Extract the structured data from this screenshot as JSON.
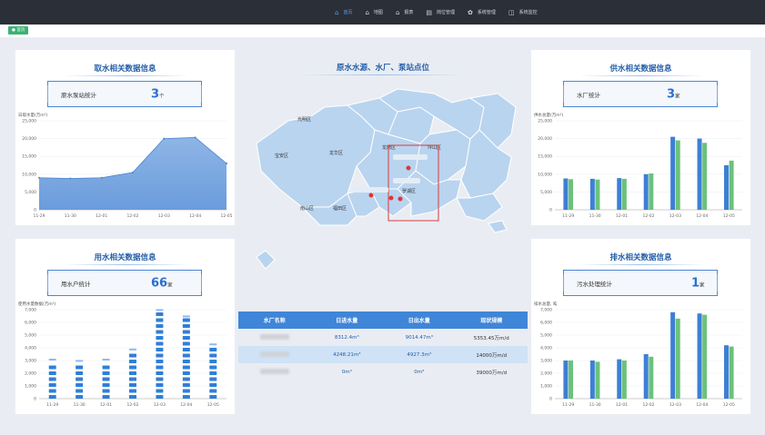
{
  "nav": {
    "items": [
      {
        "label": "首页",
        "icon": "home-icon",
        "active": true
      },
      {
        "label": "地图",
        "icon": "map-icon",
        "active": false
      },
      {
        "label": "报表",
        "icon": "report-icon",
        "active": false
      },
      {
        "label": "岗位管理",
        "icon": "user-icon",
        "active": false
      },
      {
        "label": "系统管理",
        "icon": "gear-icon",
        "active": false
      },
      {
        "label": "系统监控",
        "icon": "shield-icon",
        "active": false
      }
    ]
  },
  "tab": {
    "home_label": "首页"
  },
  "intake": {
    "title": "取水相关数据信息",
    "stat_label": "原水泵站统计",
    "stat_value": "3",
    "stat_unit": "个",
    "axis_unit": "日取水量(万m³)"
  },
  "usage": {
    "title": "用水相关数据信息",
    "stat_label": "用水户统计",
    "stat_value": "66",
    "stat_unit": "家",
    "axis_unit": "使用水量数据(万m³)"
  },
  "supply": {
    "title": "供水相关数据信息",
    "stat_label": "水厂统计",
    "stat_value": "3",
    "stat_unit": "家",
    "axis_unit": "供水总量(万m³)"
  },
  "drain": {
    "title": "排水相关数据信息",
    "stat_label": "污水处理统计",
    "stat_value": "1",
    "stat_unit": "家",
    "axis_unit": "排水总量, 吨"
  },
  "map": {
    "title": "原水水源、水厂、泵站点位",
    "districts": [
      "光明区",
      "宝安区",
      "龙华区",
      "龙岗区",
      "坪山区",
      "南山区",
      "福田区",
      "罗湖区"
    ]
  },
  "table": {
    "headers": [
      "水厂名称",
      "日进水量",
      "日出水量",
      "现状规模"
    ],
    "rows": [
      {
        "inflow": "8312.4m³",
        "outflow": "9014.47m³",
        "scale": "5353.45万m/d"
      },
      {
        "inflow": "4248.21m³",
        "outflow": "4927.3m³",
        "scale": "14000万m/d"
      },
      {
        "inflow": "0m³",
        "outflow": "0m³",
        "scale": "39000万m/d"
      }
    ]
  },
  "chart_data": [
    {
      "type": "area",
      "title": "",
      "ylabel": "日取水量(万m³)",
      "categories": [
        "11-29",
        "11-30",
        "12-01",
        "12-02",
        "12-03",
        "12-04",
        "12-05"
      ],
      "values": [
        9000,
        8800,
        9000,
        10500,
        20000,
        20300,
        13000
      ],
      "ylim": [
        0,
        25000
      ],
      "yticks": [
        "0",
        "5,000",
        "10,000",
        "15,000",
        "20,000",
        "25,000"
      ],
      "color": "#5e97d8"
    },
    {
      "type": "bar",
      "title": "",
      "ylabel": "使用水量数据(万m³)",
      "categories": [
        "11-29",
        "11-30",
        "12-01",
        "12-02",
        "12-03",
        "12-04",
        "12-05"
      ],
      "values": [
        3000,
        2900,
        3000,
        3800,
        6900,
        6400,
        4200
      ],
      "ylim": [
        0,
        7000
      ],
      "yticks": [
        "0",
        "1,000",
        "2,000",
        "3,000",
        "4,000",
        "5,000",
        "6,000",
        "7,000"
      ],
      "style": "segmented",
      "color": "#2f7fd8"
    },
    {
      "type": "bar",
      "title": "",
      "ylabel": "供水总量(万m³)",
      "categories": [
        "11-29",
        "11-30",
        "12-01",
        "12-02",
        "12-03",
        "12-04",
        "12-05"
      ],
      "series": [
        {
          "values": [
            8800,
            8700,
            8900,
            10000,
            20500,
            20000,
            12500
          ],
          "color": "#3d7fd6"
        },
        {
          "values": [
            8600,
            8500,
            8700,
            10200,
            19500,
            18800,
            13800
          ],
          "color": "#6cc27a"
        }
      ],
      "ylim": [
        0,
        25000
      ],
      "yticks": [
        "0",
        "5,000",
        "10,000",
        "15,000",
        "20,000",
        "25,000"
      ]
    },
    {
      "type": "bar",
      "title": "",
      "ylabel": "排水总量, 吨",
      "categories": [
        "11-29",
        "11-30",
        "12-01",
        "12-02",
        "12-03",
        "12-04",
        "12-05"
      ],
      "series": [
        {
          "values": [
            3000,
            3000,
            3100,
            3500,
            6800,
            6700,
            4200
          ],
          "color": "#3d7fd6"
        },
        {
          "values": [
            3000,
            2900,
            3000,
            3300,
            6300,
            6600,
            4100
          ],
          "color": "#6cc27a"
        }
      ],
      "ylim": [
        0,
        7000
      ],
      "yticks": [
        "0",
        "1,000",
        "2,000",
        "3,000",
        "4,000",
        "5,000",
        "6,000",
        "7,000"
      ]
    }
  ]
}
